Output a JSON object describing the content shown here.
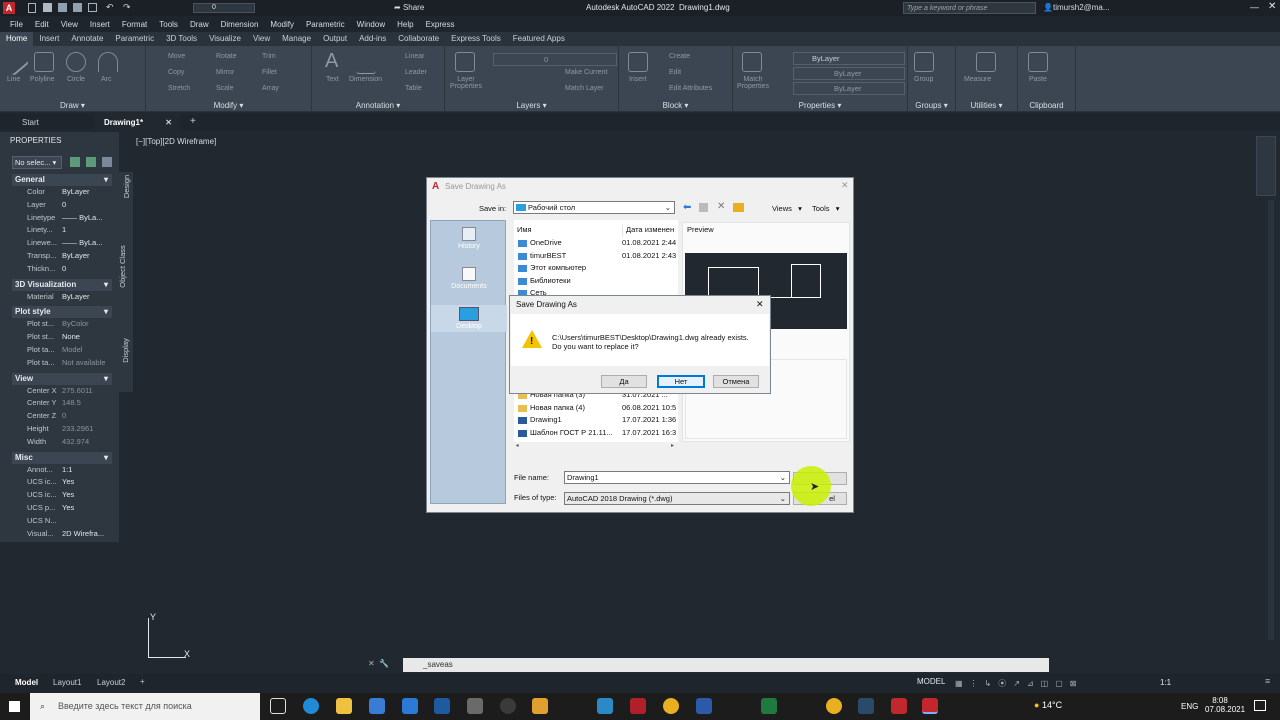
{
  "title": {
    "app": "Autodesk AutoCAD 2022",
    "file": "Drawing1.dwg",
    "share": "Share",
    "search_placeholder": "Type a keyword or phrase",
    "user": "timursh2@ma...",
    "layer_value": "0"
  },
  "menu": [
    "File",
    "Edit",
    "View",
    "Insert",
    "Format",
    "Tools",
    "Draw",
    "Dimension",
    "Modify",
    "Parametric",
    "Window",
    "Help",
    "Express"
  ],
  "ribbon_tabs": [
    "Home",
    "Insert",
    "Annotate",
    "Parametric",
    "3D Tools",
    "Visualize",
    "View",
    "Manage",
    "Output",
    "Add-ins",
    "Collaborate",
    "Express Tools",
    "Featured Apps"
  ],
  "ribbon": {
    "draw": {
      "label": "Draw",
      "tools": [
        "Line",
        "Polyline",
        "Circle",
        "Arc"
      ]
    },
    "modify": {
      "label": "Modify",
      "tools": [
        "Move",
        "Rotate",
        "Trim",
        "Copy",
        "Mirror",
        "Fillet",
        "Stretch",
        "Scale",
        "Array"
      ]
    },
    "annotation": {
      "label": "Annotation",
      "tools": [
        "Text",
        "Dimension",
        "Linear",
        "Leader",
        "Table"
      ]
    },
    "layers": {
      "label": "Layers",
      "tools": [
        "Layer Properties",
        "Make Current",
        "Match Layer"
      ],
      "layer": "0"
    },
    "block": {
      "label": "Block",
      "tools": [
        "Insert",
        "Create",
        "Edit",
        "Edit Attributes"
      ]
    },
    "properties": {
      "label": "Properties",
      "tools": [
        "Match Properties"
      ],
      "values": [
        "ByLayer",
        "ByLayer",
        "ByLayer"
      ]
    },
    "groups": {
      "label": "Groups",
      "tool": "Group"
    },
    "utilities": {
      "label": "Utilities",
      "tool": "Measure"
    },
    "clipboard": {
      "label": "Clipboard",
      "tool": "Paste"
    }
  },
  "doc_tabs": {
    "start": "Start",
    "drawing": "Drawing1*"
  },
  "viewport_label": "[−][Top][2D Wireframe]",
  "properties": {
    "title": "PROPERTIES",
    "selection": "No selec...",
    "side_tabs": [
      "Design",
      "Object Class",
      "Display"
    ],
    "sections": [
      {
        "name": "General",
        "rows": [
          [
            "Color",
            "ByLayer"
          ],
          [
            "Layer",
            "0"
          ],
          [
            "Linetype",
            "—— ByLa..."
          ],
          [
            "Linety...",
            "1"
          ],
          [
            "Linewe...",
            "—— ByLa..."
          ],
          [
            "Transp...",
            "ByLayer"
          ],
          [
            "Thickn...",
            "0"
          ]
        ]
      },
      {
        "name": "3D Visualization",
        "rows": [
          [
            "Material",
            "ByLayer"
          ]
        ]
      },
      {
        "name": "Plot style",
        "rows": [
          [
            "Plot st...",
            "ByColor"
          ],
          [
            "Plot st...",
            "None"
          ],
          [
            "Plot ta...",
            "Model"
          ],
          [
            "Plot ta...",
            "Not available"
          ]
        ]
      },
      {
        "name": "View",
        "rows": [
          [
            "Center X",
            "275.6011"
          ],
          [
            "Center Y",
            "148.5"
          ],
          [
            "Center Z",
            "0"
          ],
          [
            "Height",
            "233.2961"
          ],
          [
            "Width",
            "432.974"
          ]
        ]
      },
      {
        "name": "Misc",
        "rows": [
          [
            "Annot...",
            "1:1"
          ],
          [
            "UCS ic...",
            "Yes"
          ],
          [
            "UCS ic...",
            "Yes"
          ],
          [
            "UCS p...",
            "Yes"
          ],
          [
            "UCS N...",
            ""
          ],
          [
            "Visual...",
            "2D Wirefra..."
          ]
        ]
      }
    ]
  },
  "save_dialog": {
    "title": "Save Drawing As",
    "save_in_label": "Save in:",
    "save_in_value": "Рабочий стол",
    "views": "Views",
    "tools": "Tools",
    "col_name": "Имя",
    "col_date": "Дата изменен",
    "preview_label": "Preview",
    "places": [
      "History",
      "Documents",
      "Desktop"
    ],
    "files_top": [
      [
        "OneDrive",
        "01.08.2021 2:44"
      ],
      [
        "timurBEST",
        "01.08.2021 2:43"
      ],
      [
        "Этот компьютер",
        ""
      ],
      [
        "Библиотеки",
        ""
      ],
      [
        "Сеть",
        ""
      ]
    ],
    "files_bottom": [
      [
        "Новая папка (3)",
        "31.07.2021 ..."
      ],
      [
        "Новая папка (4)",
        "06.08.2021 10:5"
      ],
      [
        "Drawing1",
        "17.07.2021 1:36"
      ],
      [
        "Шаблон ГОСТ Р 21.11...",
        "17.07.2021 16:3"
      ]
    ],
    "file_name_label": "File name:",
    "file_name": "Drawing1",
    "file_type_label": "Files of type:",
    "file_type": "AutoCAD 2018 Drawing (*.dwg)",
    "cancel_partial": "el"
  },
  "confirm_dialog": {
    "title": "Save Drawing As",
    "message1": "C:\\Users\\timurBEST\\Desktop\\Drawing1.dwg already exists.",
    "message2": "Do you want to replace it?",
    "yes": "Да",
    "no": "Нет",
    "cancel": "Отмена"
  },
  "command_line": "_saveas",
  "layout_tabs": [
    "Model",
    "Layout1",
    "Layout2"
  ],
  "status": {
    "model": "MODEL",
    "scale": "1:1"
  },
  "taskbar": {
    "search": "Введите здесь текст для поиска",
    "temp": "14°C",
    "lang": "ENG",
    "time": "8:08",
    "date": "07.08.2021"
  },
  "colors": {
    "canvas": "#212830",
    "ribbon": "#3b4652",
    "accent_cursor": "#c8f000"
  }
}
